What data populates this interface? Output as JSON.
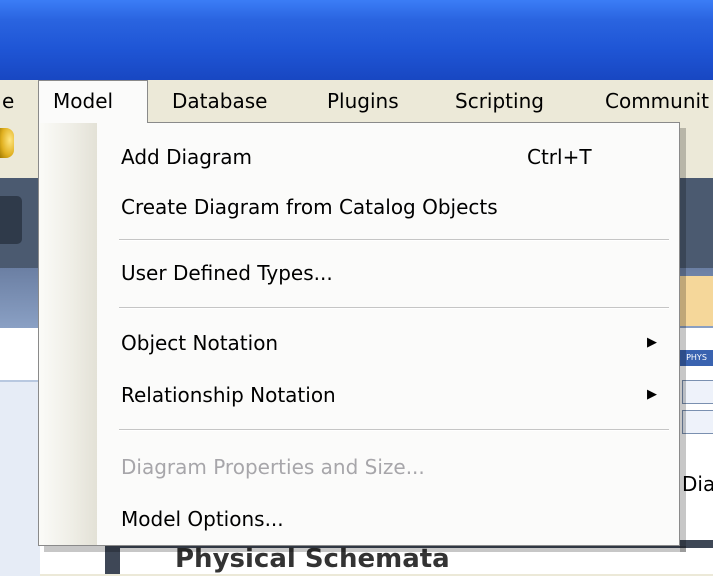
{
  "menubar": {
    "items": [
      {
        "label": "e"
      },
      {
        "label": "Model"
      },
      {
        "label": "Database"
      },
      {
        "label": "Plugins"
      },
      {
        "label": "Scripting"
      },
      {
        "label": "Communit"
      }
    ]
  },
  "dropdown": {
    "items": [
      {
        "label": "Add Diagram",
        "shortcut": "Ctrl+T"
      },
      {
        "label": "Create Diagram from Catalog Objects"
      },
      {
        "label": "User Defined Types..."
      },
      {
        "label": "Object Notation",
        "submenu_arrow": "▶"
      },
      {
        "label": "Relationship Notation",
        "submenu_arrow": "▶"
      },
      {
        "label": "Diagram Properties and Size...",
        "disabled": true
      },
      {
        "label": "Model Options..."
      }
    ]
  },
  "background": {
    "right_text": "Dia",
    "chip_text": "PHYS",
    "heading_text": "Physical Schemata"
  }
}
